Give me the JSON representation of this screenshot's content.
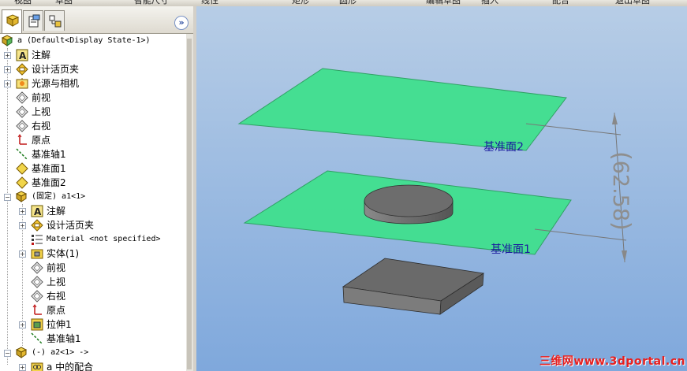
{
  "menu": {
    "items": [
      "视图",
      "草图",
      "智能尺寸",
      "线性",
      "矩形",
      "圆形",
      "编辑草图",
      "插入",
      "配合",
      "退出草图"
    ]
  },
  "panel": {
    "tabs": [
      "feature-manager",
      "property-manager",
      "configuration-manager"
    ],
    "collapse_glyph": "»"
  },
  "tree": {
    "root": "a  (Default<Display State-1>)",
    "items": [
      "注解",
      "设计活页夹",
      "光源与相机",
      "前视",
      "上视",
      "右视",
      "原点",
      "基准轴1",
      "基准面1",
      "基准面2",
      "(固定) a1<1>",
      "注解",
      "设计活页夹",
      "Material <not specified>",
      "实体(1)",
      "前视",
      "上视",
      "右视",
      "原点",
      "拉伸1",
      "基准轴1",
      "(-) a2<1> ->",
      "a 中的配合"
    ]
  },
  "viewport": {
    "plane_top_label": "基准面2",
    "plane_bottom_label": "基准面1",
    "dimension": "62.58",
    "watermark": "三维网www.3dportal.cn",
    "colors": {
      "plane": "#40e08e",
      "part": "#6e6e6e",
      "background": "#8fb4e2"
    }
  }
}
